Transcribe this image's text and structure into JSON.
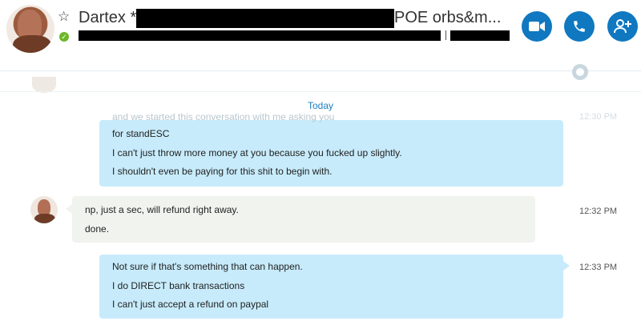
{
  "header": {
    "contact_name": "Dartex *",
    "title_suffix": "POE orbs&m...",
    "presence": "online",
    "buttons": {
      "video_call": "video-camera-icon",
      "voice_call": "phone-icon",
      "add_people": "add-person-icon"
    },
    "accent_color": "#0f78c0"
  },
  "chat": {
    "date_divider": "Today",
    "messages": [
      {
        "direction": "outgoing",
        "lines": [
          "and we started this conversation with me asking you",
          "for standESC",
          "I can't just throw more money at you because you fucked up slightly.",
          "I shouldn't even be paying for this shit to begin with."
        ],
        "time": "12:30 PM"
      },
      {
        "direction": "incoming",
        "lines": [
          "np, just a sec, will refund right away.",
          "done."
        ],
        "time": "12:32 PM"
      },
      {
        "direction": "outgoing",
        "lines": [
          "Not sure if that's something that can happen.",
          "I do DIRECT bank transactions",
          "I can't just accept a refund on paypal"
        ],
        "time": "12:33 PM"
      }
    ],
    "outgoing_bubble_color": "#c7ebfb",
    "incoming_bubble_color": "#f1f3ef"
  }
}
